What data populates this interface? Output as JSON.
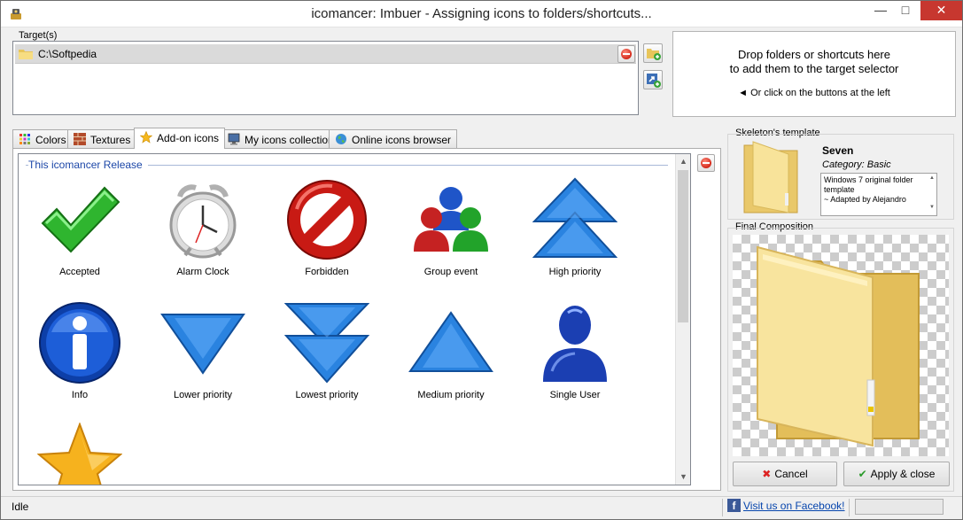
{
  "window": {
    "title": "icomancer: Imbuer - Assigning icons to folders/shortcuts...",
    "icons": [
      "app-icon",
      "minimize-icon",
      "maximize-icon",
      "close-icon"
    ]
  },
  "targets": {
    "label": "Target(s)",
    "items": [
      {
        "path": "C:\\Softpedia"
      }
    ]
  },
  "drop_hint": {
    "line1": "Drop folders or shortcuts here",
    "line2": "to add them to the target selector",
    "line3": "◄ Or click on the buttons at the left"
  },
  "tabs": [
    {
      "label": "Colors",
      "icon": "palette-icon"
    },
    {
      "label": "Textures",
      "icon": "brick-icon"
    },
    {
      "label": "Add-on icons",
      "icon": "star-icon",
      "active": true
    },
    {
      "label": "My icons collection",
      "icon": "monitor-icon"
    },
    {
      "label": "Online icons browser",
      "icon": "globe-icon"
    }
  ],
  "release": {
    "title": "This icomancer Release",
    "icons": [
      {
        "label": "Accepted",
        "icon": "checkmark-icon"
      },
      {
        "label": "Alarm Clock",
        "icon": "alarm-clock-icon"
      },
      {
        "label": "Forbidden",
        "icon": "forbidden-icon"
      },
      {
        "label": "Group event",
        "icon": "group-users-icon"
      },
      {
        "label": "High priority",
        "icon": "double-up-arrow-icon"
      },
      {
        "label": "Info",
        "icon": "info-icon"
      },
      {
        "label": "Lower priority",
        "icon": "down-arrow-icon"
      },
      {
        "label": "Lowest priority",
        "icon": "double-down-arrow-icon"
      },
      {
        "label": "Medium priority",
        "icon": "up-arrow-icon"
      },
      {
        "label": "Single User",
        "icon": "user-icon"
      },
      {
        "label": "",
        "icon": "star-icon"
      }
    ]
  },
  "skeleton": {
    "label": "Skeleton's template",
    "name": "Seven",
    "category": "Category: Basic",
    "description_line1": "Windows 7 original folder",
    "description_line2": "template",
    "description_line3": "~ Adapted by Alejandro"
  },
  "composition": {
    "label": "Final Composition",
    "cancel_label": "Cancel",
    "apply_label": "Apply & close"
  },
  "status": {
    "text": "Idle",
    "facebook_label": "Visit us on Facebook!"
  },
  "colors": {
    "accent_blue": "#1c47a8",
    "close_red": "#c7372f",
    "folder_yellow": "#f7e08a"
  }
}
